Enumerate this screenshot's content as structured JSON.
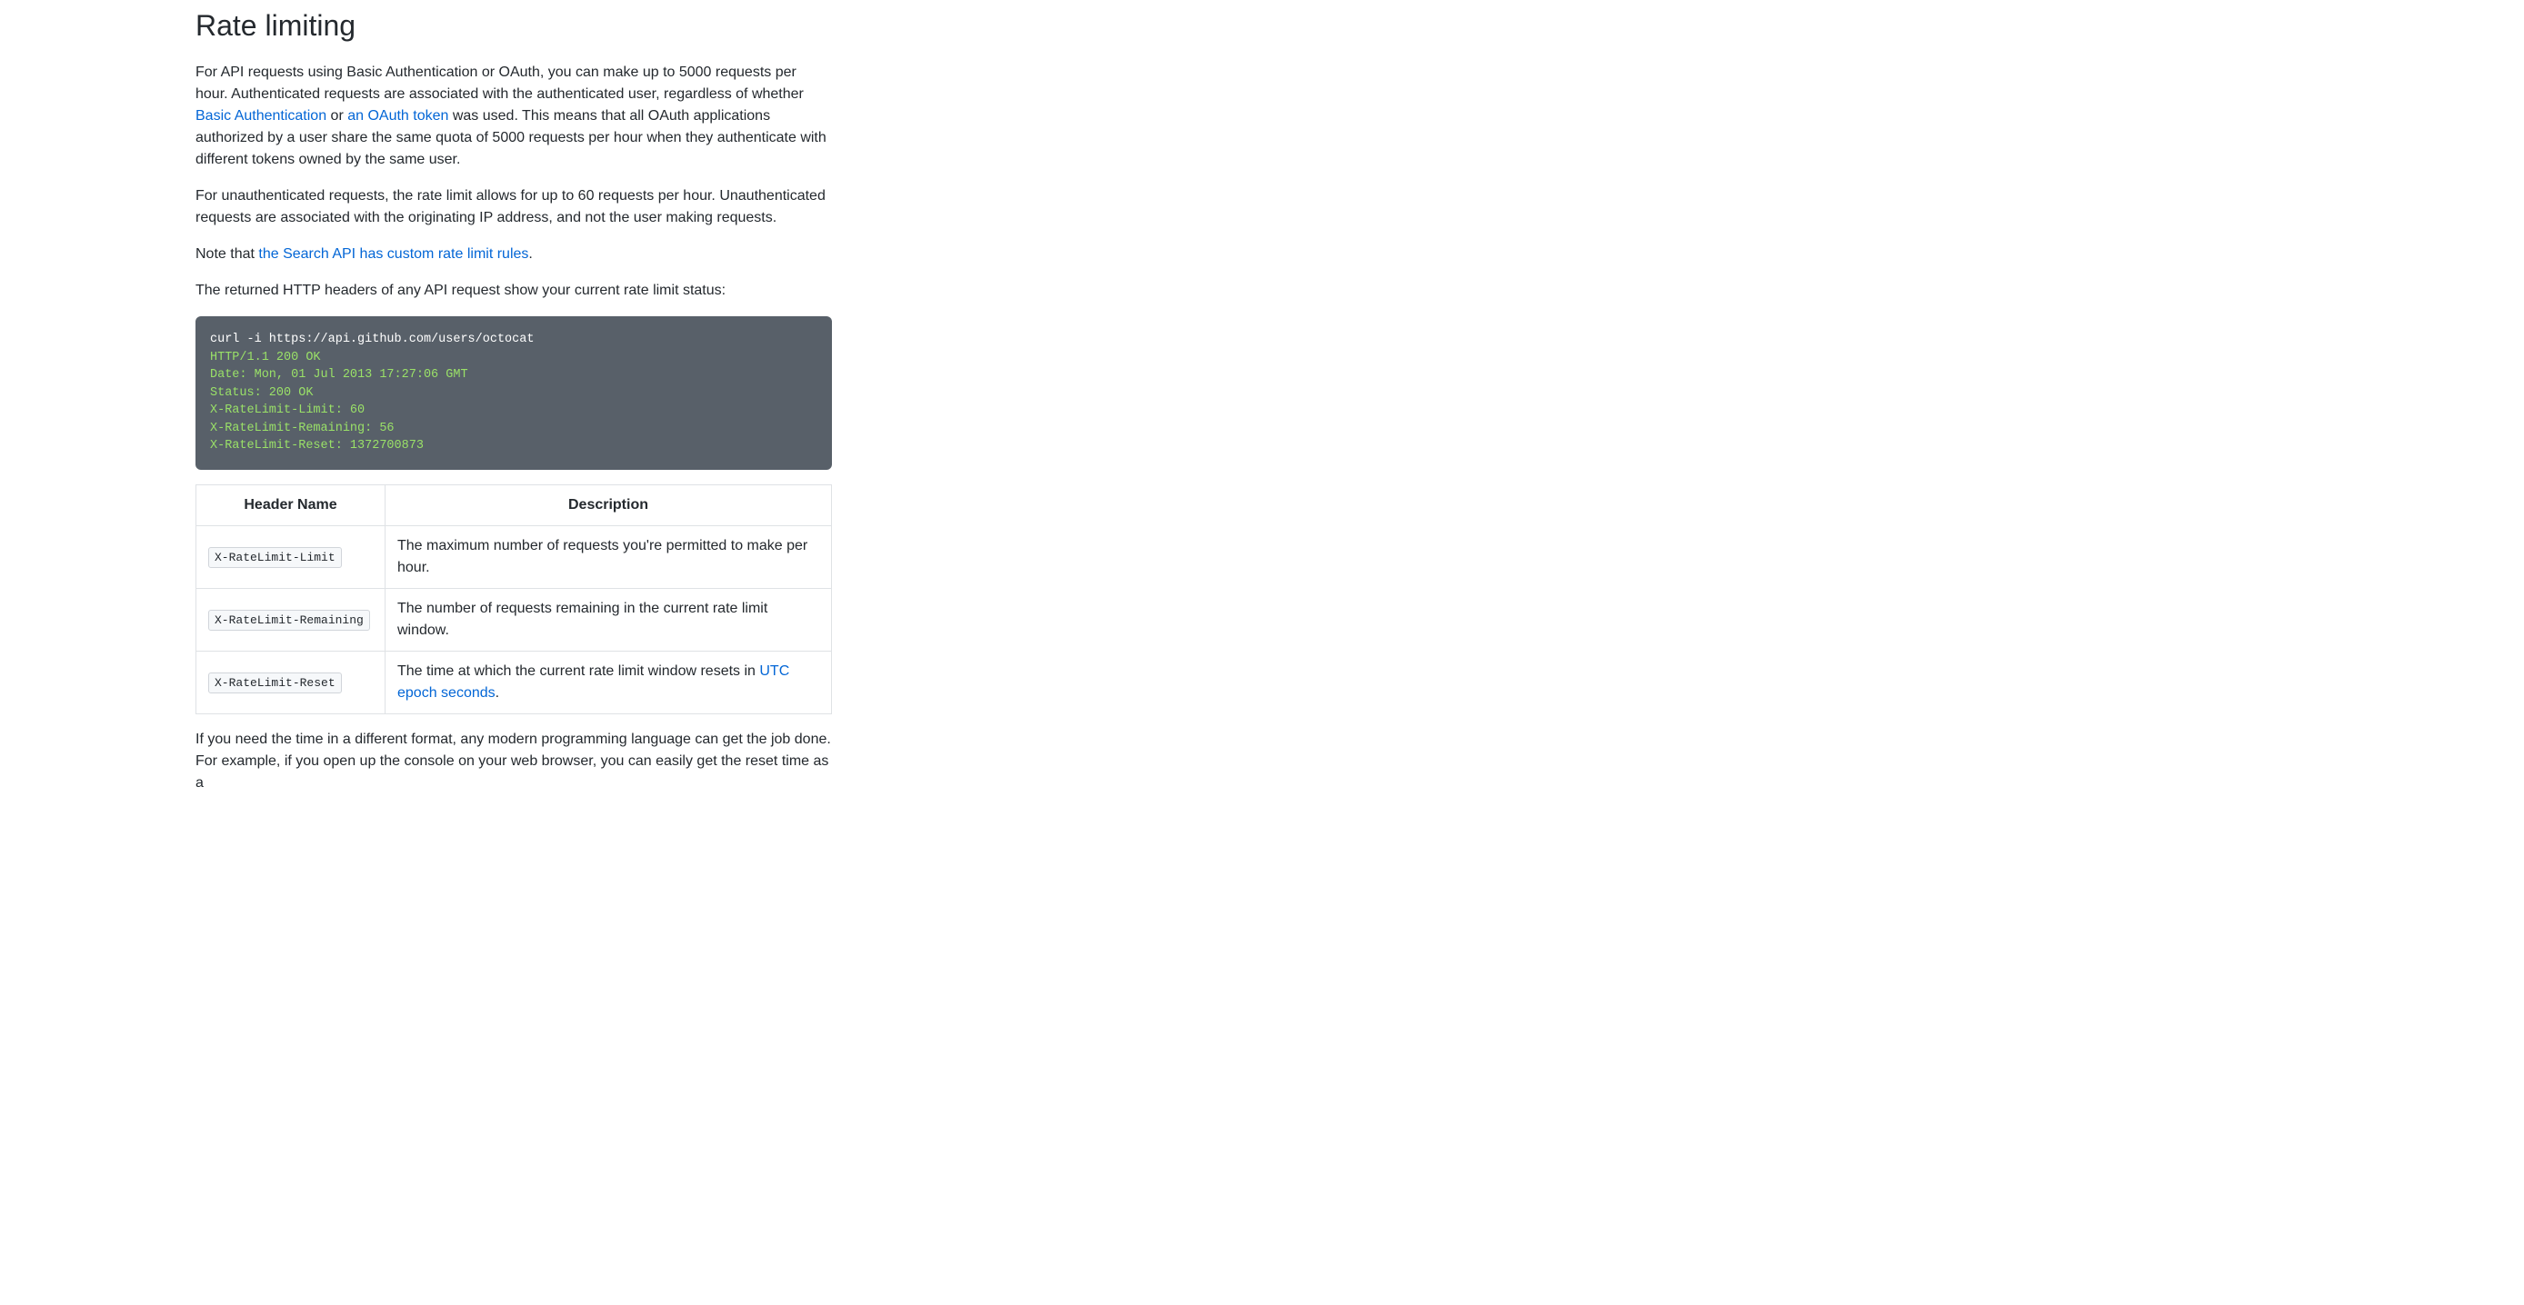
{
  "heading": "Rate limiting",
  "p1": {
    "t1": "For API requests using Basic Authentication or OAuth, you can make up to 5000 requests per hour. Authenticated requests are associated with the authenticated user, regardless of whether ",
    "link1": "Basic Authentication",
    "t2": " or ",
    "link2": "an OAuth token",
    "t3": " was used. This means that all OAuth applications authorized by a user share the same quota of 5000 requests per hour when they authenticate with different tokens owned by the same user."
  },
  "p2": "For unauthenticated requests, the rate limit allows for up to 60 requests per hour. Unauthenticated requests are associated with the originating IP address, and not the user making requests.",
  "p3": {
    "t1": "Note that ",
    "link1": "the Search API has custom rate limit rules",
    "t2": "."
  },
  "p4": "The returned HTTP headers of any API request show your current rate limit status:",
  "code": {
    "cmd": "curl -i https://api.github.com/users/octocat",
    "l1": "HTTP/1.1 200 OK",
    "l2": "Date: Mon, 01 Jul 2013 17:27:06 GMT",
    "l3": "Status: 200 OK",
    "l4": "X-RateLimit-Limit: 60",
    "l5": "X-RateLimit-Remaining: 56",
    "l6": "X-RateLimit-Reset: 1372700873"
  },
  "table": {
    "h1": "Header Name",
    "h2": "Description",
    "rows": [
      {
        "name": "X-RateLimit-Limit",
        "desc_t1": "The maximum number of requests you're permitted to make per hour."
      },
      {
        "name": "X-RateLimit-Remaining",
        "desc_t1": "The number of requests remaining in the current rate limit window."
      },
      {
        "name": "X-RateLimit-Reset",
        "desc_t1": "The time at which the current rate limit window resets in ",
        "link": "UTC epoch seconds",
        "desc_t2": "."
      }
    ]
  },
  "p5": "If you need the time in a different format, any modern programming language can get the job done. For example, if you open up the console on your web browser, you can easily get the reset time as a"
}
